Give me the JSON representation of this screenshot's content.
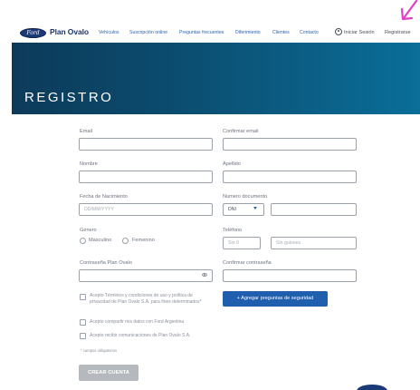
{
  "header": {
    "logo_text": "Ford",
    "brand": "Plan Ovalo",
    "nav": [
      "Vehículos",
      "Suscripción online",
      "Preguntas frecuentes",
      "Diferimiento",
      "Clientes",
      "Contacto"
    ],
    "login": "Iniciar Sesión",
    "register": "Registrarse"
  },
  "hero": {
    "title": "REGISTRO"
  },
  "form": {
    "email": {
      "label": "Email",
      "value": ""
    },
    "confirm_email": {
      "label": "Confirmar email",
      "value": ""
    },
    "nombre": {
      "label": "Nombre",
      "value": ""
    },
    "apellido": {
      "label": "Apellido",
      "value": ""
    },
    "fecha": {
      "label": "Fecha de Nacimiento",
      "placeholder": "DD/MM/YYYY"
    },
    "documento": {
      "label": "Numero documento",
      "type": "DNI",
      "value": ""
    },
    "genero": {
      "label": "Género",
      "options": [
        "Masculino",
        "Femenino"
      ]
    },
    "telefono": {
      "label": "Teléfono",
      "area_placeholder": "Sin 0",
      "number_placeholder": "Sin guiones"
    },
    "password": {
      "label": "Contraseña Plan Ovalo",
      "value": ""
    },
    "confirm_password": {
      "label": "Confirmar contraseña",
      "value": ""
    },
    "checks": [
      "Acepto Términos y condiciones de uso y política de privacidad de Plan Ovalo S.A. para fines determinados*",
      "Acepto compartir mis datos con Ford Argentina",
      "Acepto recibir comunicaciones de Plan Ovalo S.A."
    ],
    "security_button": "+ Agregar preguntas de seguridad",
    "required_note": "* campos obligatorios",
    "submit": "CREAR CUENTA"
  },
  "colors": {
    "hero_start": "#0d3a5a",
    "hero_end": "#0a6e98",
    "primary": "#1f5fae",
    "annotation": "#e040c8"
  }
}
